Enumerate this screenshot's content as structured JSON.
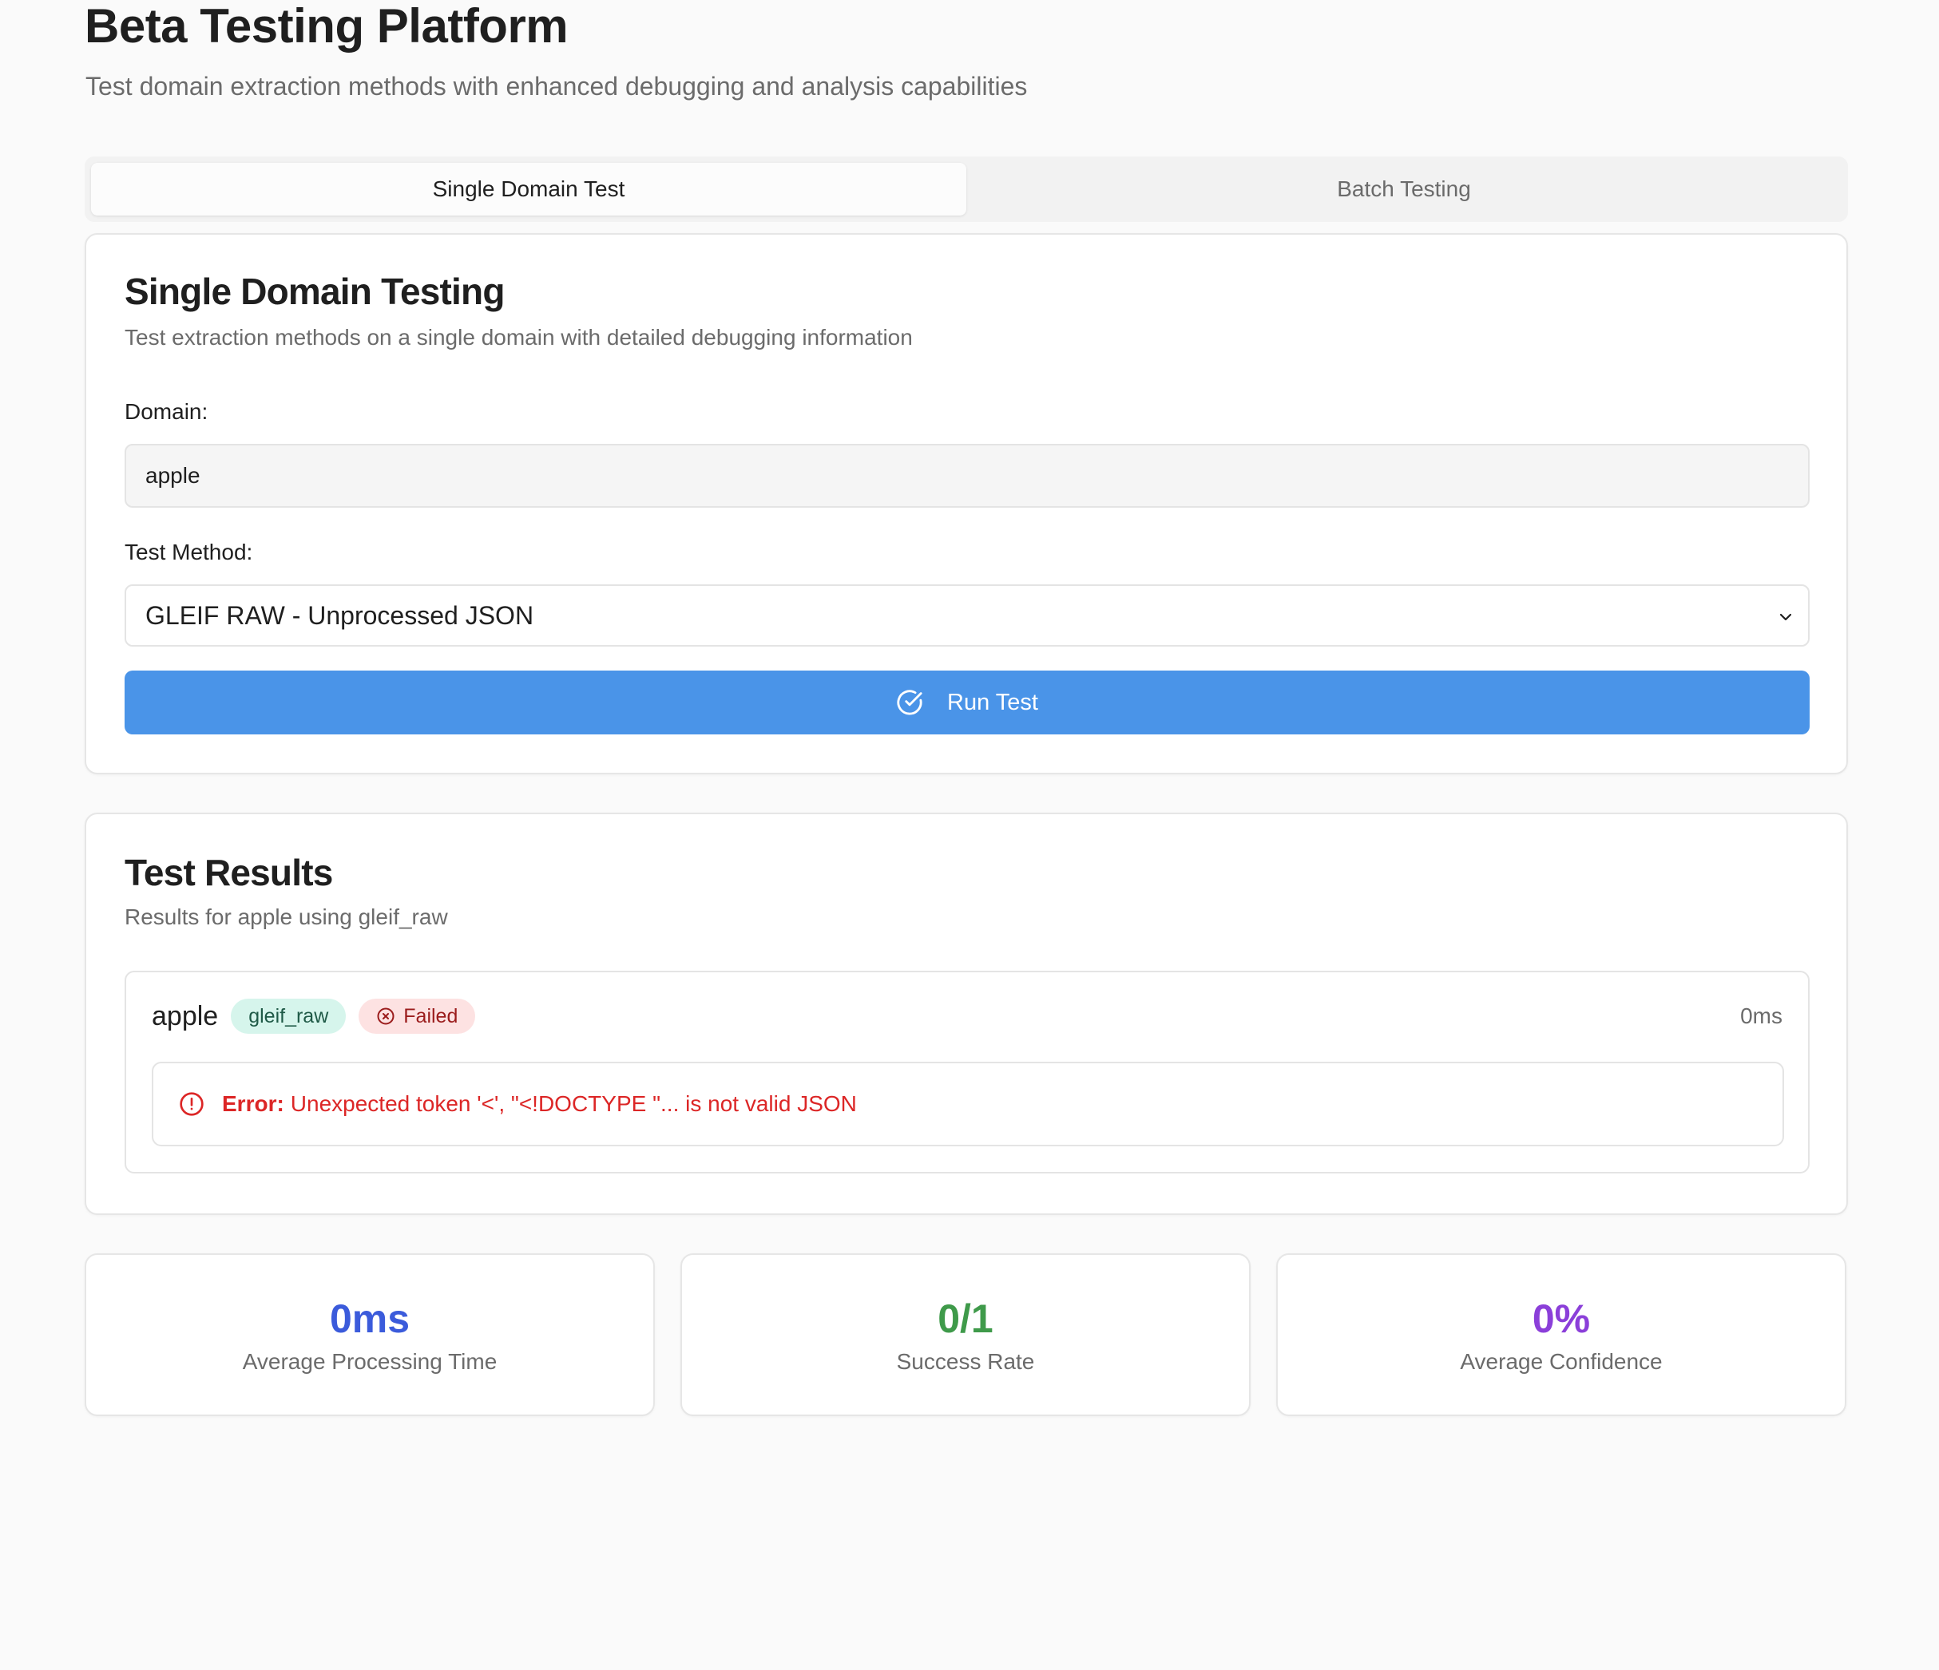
{
  "header": {
    "title": "Beta Testing Platform",
    "subtitle": "Test domain extraction methods with enhanced debugging and analysis capabilities"
  },
  "tabs": [
    {
      "label": "Single Domain Test",
      "active": true
    },
    {
      "label": "Batch Testing",
      "active": false
    }
  ],
  "single_test": {
    "title": "Single Domain Testing",
    "description": "Test extraction methods on a single domain with detailed debugging information",
    "domain_label": "Domain:",
    "domain_value": "apple",
    "method_label": "Test Method:",
    "method_selected": "GLEIF RAW - Unprocessed JSON",
    "run_button": "Run Test",
    "accent_color": "#4a94e8"
  },
  "results": {
    "title": "Test Results",
    "description": "Results for apple using gleif_raw",
    "item": {
      "domain": "apple",
      "method": "gleif_raw",
      "status": "Failed",
      "time": "0ms",
      "error_label": "Error:",
      "error_message": "Unexpected token '<', \"<!DOCTYPE \"... is not valid JSON",
      "error_color": "#dc2626"
    }
  },
  "stats": [
    {
      "value": "0ms",
      "label": "Average Processing Time",
      "color": "#3b5bdb"
    },
    {
      "value": "0/1",
      "label": "Success Rate",
      "color": "#3f9a4a"
    },
    {
      "value": "0%",
      "label": "Average Confidence",
      "color": "#8b3fd9"
    }
  ]
}
